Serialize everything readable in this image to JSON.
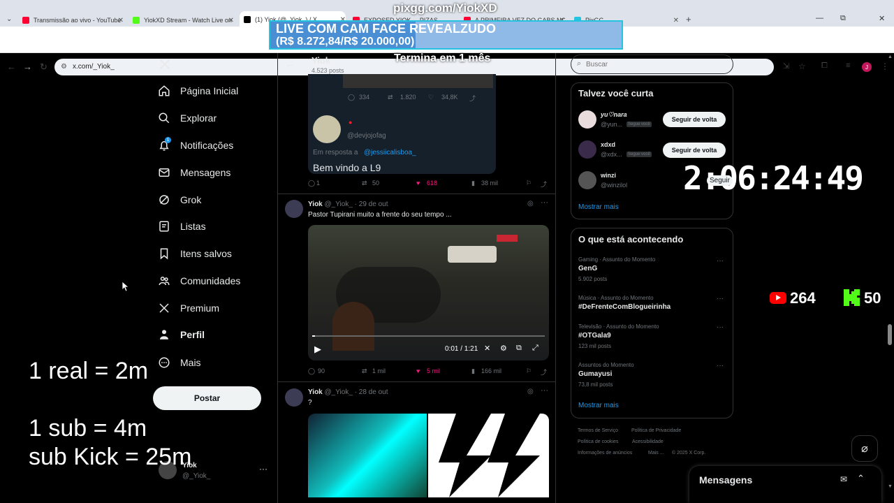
{
  "overlay": {
    "pix_url": "pixgg.com/YiokXD",
    "banner_line1": "LIVE COM CAM FACE REVEALZUDO",
    "banner_line2": "(R$ 8.272,84/R$ 20.000,00)",
    "banner_progress": 0.4136,
    "termina": "Termina em 1 mês",
    "rate1": "1 real = 2m",
    "rate2": "1 sub = 4m",
    "rate3": "sub Kick = 25m",
    "countdown": "2:06:24:49",
    "youtube_count": "264",
    "kick_count": "50"
  },
  "browser": {
    "tabs": [
      {
        "label": "Transmissão ao vivo - YouTube",
        "color": "#ff0033"
      },
      {
        "label": "YiokXD Stream - Watch Live on",
        "color": "#53fc18"
      },
      {
        "label": "(1) Yiok (@_Yiok_) / X",
        "color": "#000000"
      },
      {
        "label": "EXPOSED YIOK ... PIZAS",
        "color": "#ff0033"
      },
      {
        "label": "A PRIMEIRA VEZ DO GABS NO",
        "color": "#ff0033"
      },
      {
        "label": "PixGG",
        "color": "#24c4e0"
      }
    ],
    "url": "x.com/_Yiok_"
  },
  "nav": {
    "items": [
      {
        "label": "Página Inicial",
        "icon": "home-icon"
      },
      {
        "label": "Explorar",
        "icon": "search-icon"
      },
      {
        "label": "Notificações",
        "icon": "bell-icon",
        "badge": "1"
      },
      {
        "label": "Mensagens",
        "icon": "mail-icon"
      },
      {
        "label": "Grok",
        "icon": "grok-icon"
      },
      {
        "label": "Listas",
        "icon": "list-icon"
      },
      {
        "label": "Itens salvos",
        "icon": "bookmark-icon"
      },
      {
        "label": "Comunidades",
        "icon": "people-icon"
      },
      {
        "label": "Premium",
        "icon": "x-logo-icon"
      },
      {
        "label": "Perfil",
        "icon": "person-icon"
      },
      {
        "label": "Mais",
        "icon": "more-icon"
      }
    ],
    "post_label": "Postar",
    "account_name": "Yiok",
    "account_handle": "@_Yiok_"
  },
  "profile_header": {
    "name": "Yiok",
    "posts": "4.523 posts"
  },
  "feed": {
    "embedded_stats": {
      "replies": "334",
      "reposts": "1.820",
      "likes": "34,8K"
    },
    "embedded_handle": "@devjojofag",
    "embedded_reply_prefix": "Em resposta a",
    "embedded_reply_to": "@jessiicalisboa_",
    "embedded_text": "Bem vindo a L9",
    "tweet0_actions": {
      "replies": "1",
      "reposts": "50",
      "likes": "618",
      "views": "38 mil"
    },
    "tweet1": {
      "name": "Yiok",
      "handle": "@_Yiok_",
      "date": "· 29 de out",
      "text": "Pastor Tupirani muito a frente do seu tempo ...",
      "video_time": "0:01 / 1:21",
      "video_progress": 0.013,
      "replies": "90",
      "reposts": "1 mil",
      "likes": "5 mil",
      "views": "166 mil"
    },
    "tweet2": {
      "name": "Yiok",
      "handle": "@_Yiok_",
      "date": "· 28 de out",
      "text": "?"
    }
  },
  "right": {
    "search_placeholder": "Buscar",
    "suggest_title": "Talvez você curta",
    "suggestions": [
      {
        "name": "yu♡nara",
        "handle": "@yun...",
        "tag": "Segue você",
        "btn": "Seguir de volta"
      },
      {
        "name": "xdxd",
        "handle": "@xdx...",
        "tag": "Segue você",
        "btn": "Seguir de volta"
      },
      {
        "name": "winzi",
        "handle": "@winzilol",
        "tag": "",
        "btn": "Seguir"
      }
    ],
    "show_more": "Mostrar mais",
    "trends_title": "O que está acontecendo",
    "trends": [
      {
        "cat": "Gaming · Assunto do Momento",
        "name": "GenG",
        "posts": "5.902 posts"
      },
      {
        "cat": "Música · Assunto do Momento",
        "name": "#DeFrenteComBlogueirinha",
        "posts": ""
      },
      {
        "cat": "Televisão · Assunto do Momento",
        "name": "#OTGala9",
        "posts": "123 mil posts"
      },
      {
        "cat": "Assuntos do Momento",
        "name": "Gumayusi",
        "posts": "73,8 mil posts"
      }
    ],
    "trends_more": "Mostrar mais",
    "footer": [
      "Termos de Serviço",
      "Política de Privacidade",
      "Política de cookies",
      "Acessibilidade",
      "Informações de anúncios",
      "Mais ...",
      "© 2025 X Corp."
    ],
    "messages_label": "Mensagens"
  }
}
